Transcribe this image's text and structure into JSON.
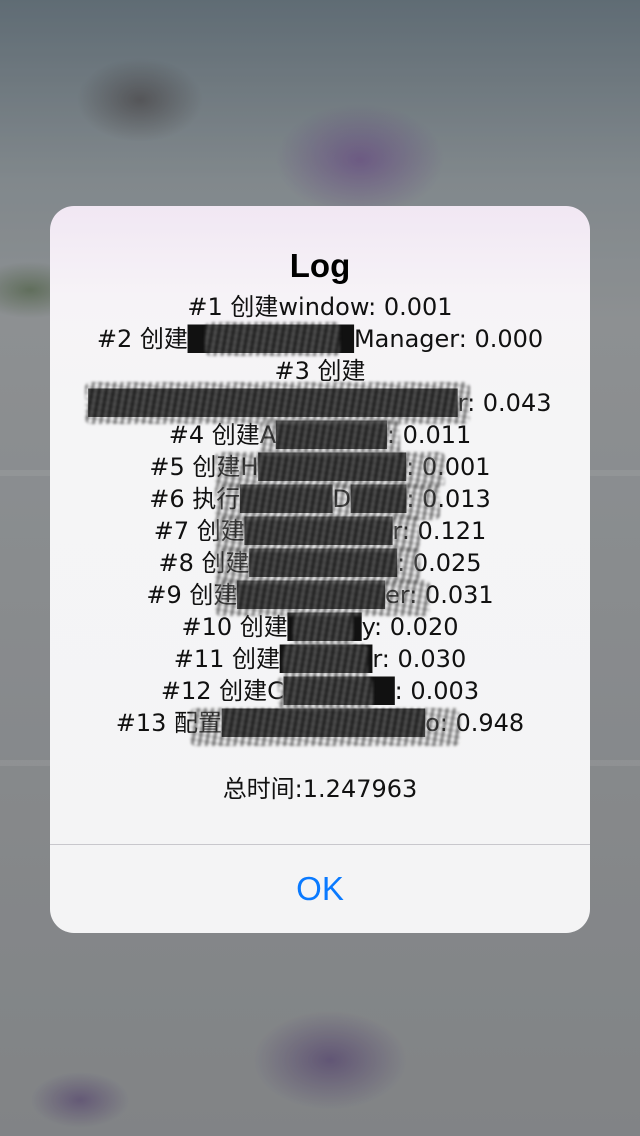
{
  "alert": {
    "title": "Log",
    "lines": [
      "#1 创建window: 0.001",
      "#2 创建█████████Manager: 0.000",
      "#3 创建",
      "████████████████████r: 0.043",
      "#4 创建A██████: 0.011",
      "#5 创建H████████: 0.001",
      "#6 执行█████D███: 0.013",
      "#7 创建████████r: 0.121",
      "#8 创建████████: 0.025",
      "#9 创建████████er: 0.031",
      "#10 创建████y: 0.020",
      "#11 创建█████r: 0.030",
      "#12 创建C██████: 0.003",
      "#13 配置███████████o: 0.948"
    ],
    "total": "总时间:1.247963",
    "ok_label": "OK"
  },
  "colors": {
    "accent": "#0a7aff",
    "alert_background": "#f4f4f5",
    "divider": "#c8c7cc"
  }
}
